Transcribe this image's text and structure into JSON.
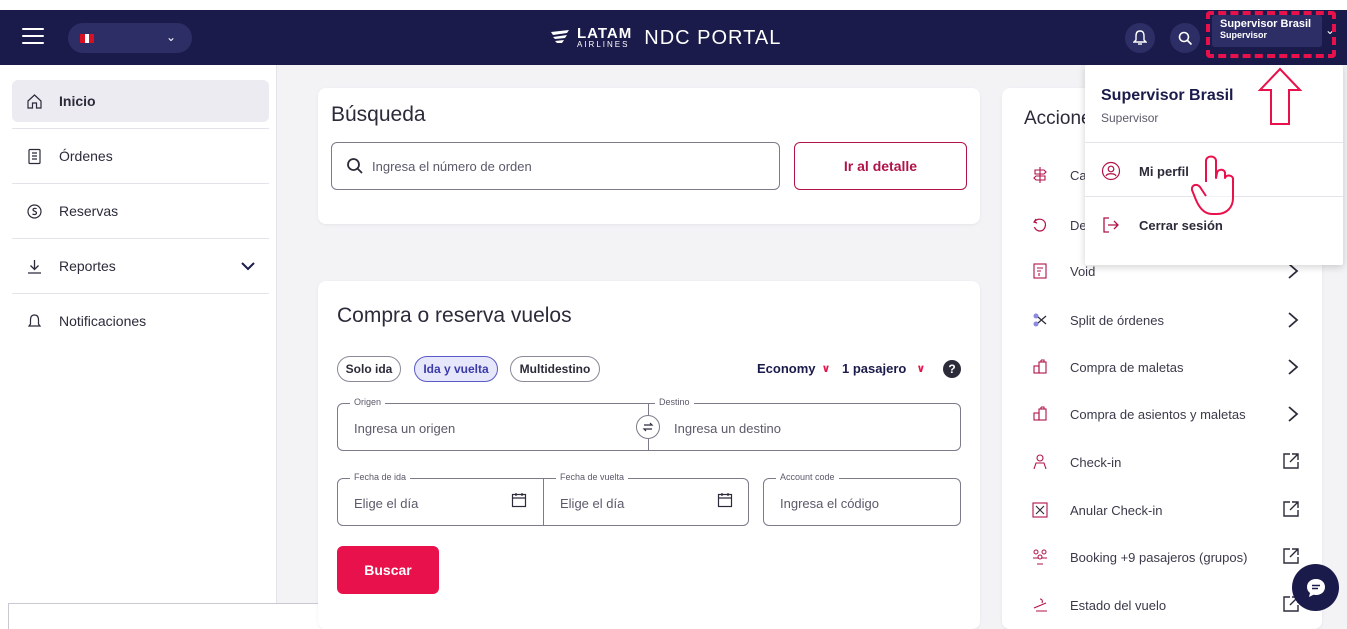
{
  "header": {
    "brand_name": "LATAM",
    "brand_sub": "AIRLINES",
    "portal_title": "NDC PORTAL",
    "user_name": "Supervisor Brasil",
    "user_role": "Supervisor",
    "flag_colors": [
      "#d91023",
      "#ffffff",
      "#d91023"
    ]
  },
  "sidebar": {
    "items": [
      {
        "label": "Inicio",
        "icon": "home-icon"
      },
      {
        "label": "Órdenes",
        "icon": "document-icon"
      },
      {
        "label": "Reservas",
        "icon": "coin-icon"
      },
      {
        "label": "Reportes",
        "icon": "download-icon"
      },
      {
        "label": "Notificaciones",
        "icon": "bell-icon"
      }
    ]
  },
  "search": {
    "title": "Búsqueda",
    "placeholder": "Ingresa el número de orden",
    "button": "Ir al detalle"
  },
  "booking": {
    "title": "Compra o reserva vuelos",
    "trip_types": [
      "Solo ida",
      "Ida y vuelta",
      "Multidestino"
    ],
    "selected_trip": "Ida y vuelta",
    "cabin": "Economy",
    "passengers": "1 pasajero",
    "origin_label": "Origen",
    "origin_placeholder": "Ingresa un origen",
    "destination_label": "Destino",
    "destination_placeholder": "Ingresa un destino",
    "depart_label": "Fecha de ida",
    "depart_placeholder": "Elige el día",
    "return_label": "Fecha de vuelta",
    "return_placeholder": "Elige el día",
    "account_label": "Account code",
    "account_placeholder": "Ingresa el código",
    "search_button": "Buscar"
  },
  "actions": {
    "title": "Accione",
    "items": [
      {
        "label": "Ca",
        "icon": "signpost-icon"
      },
      {
        "label": "De",
        "icon": "undo-icon"
      },
      {
        "label": "Void",
        "icon": "receipt-icon"
      },
      {
        "label": "Split de órdenes",
        "icon": "scissors-icon"
      },
      {
        "label": "Compra de maletas",
        "icon": "luggage-icon"
      },
      {
        "label": "Compra de asientos y maletas",
        "icon": "luggage-icon"
      },
      {
        "label": "Check-in",
        "icon": "person-icon"
      },
      {
        "label": "Anular Check-in",
        "icon": "cancel-box-icon"
      },
      {
        "label": "Booking +9 pasajeros (grupos)",
        "icon": "group-icon"
      },
      {
        "label": "Estado del vuelo",
        "icon": "flight-status-icon"
      }
    ]
  },
  "profile_menu": {
    "name": "Supervisor Brasil",
    "role": "Supervisor",
    "items": [
      {
        "label": "Mi perfil",
        "icon": "user-circle-icon"
      },
      {
        "label": "Cerrar sesión",
        "icon": "logout-icon"
      }
    ]
  },
  "colors": {
    "navy": "#1b1b4b",
    "accent": "#e8114b",
    "highlight": "#e8114b"
  }
}
